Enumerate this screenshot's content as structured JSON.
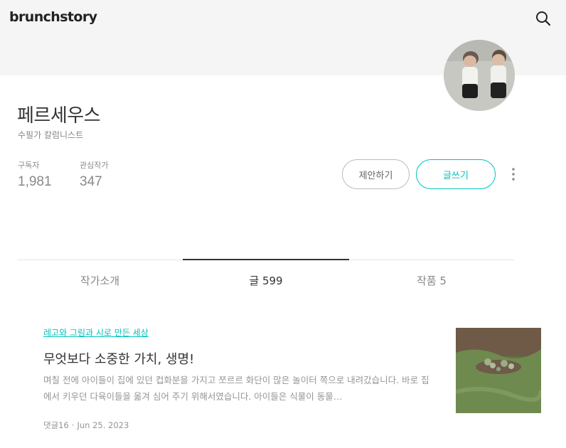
{
  "header": {
    "logo": "brunchstory",
    "search_icon": "search-icon"
  },
  "profile": {
    "name": "페르세우스",
    "job": "수필가 칼럼니스트",
    "stats": [
      {
        "label": "구독자",
        "value": "1,981"
      },
      {
        "label": "관심작가",
        "value": "347"
      }
    ],
    "propose_label": "제안하기",
    "write_label": "글쓰기",
    "more_icon": "more-vertical-icon"
  },
  "tabs": [
    {
      "label": "작가소개"
    },
    {
      "label": "글 599"
    },
    {
      "label": "작품 5"
    }
  ],
  "active_tab": "글 599",
  "post": {
    "magazine": "레고와 그림과 시로 만든 세상",
    "title": "무엇보다 소중한 가치, 생명!",
    "summary": "며칠 전에 아이들이 집에 있던 컵화분을 가지고 쪼르르 화단이 많은 놀이터 쪽으로 내려갔습니다. 바로 집에서 키우던 다육이들을 옮겨 심어 주기 위해서였습니다. 아이들은 식물이 동물…",
    "comments": "댓글16",
    "date": "Jun 25. 2023"
  },
  "colors": {
    "accent": "#00c3bd",
    "header_bg": "#f5f5f5"
  }
}
